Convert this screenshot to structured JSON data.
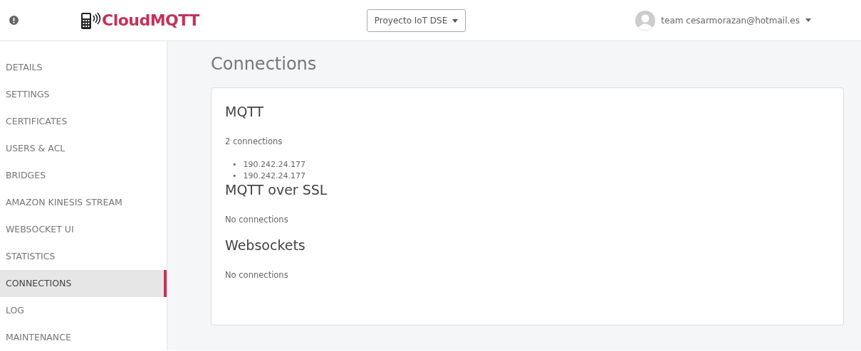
{
  "header": {
    "brand": "CloudMQTT",
    "instance_select": "Proyecto IoT DSE",
    "user": "team cesarmorazan@hotmail.es"
  },
  "sidebar": {
    "items": [
      {
        "label": "DETAILS",
        "selected": false
      },
      {
        "label": "SETTINGS",
        "selected": false
      },
      {
        "label": "CERTIFICATES",
        "selected": false
      },
      {
        "label": "USERS & ACL",
        "selected": false
      },
      {
        "label": "BRIDGES",
        "selected": false
      },
      {
        "label": "AMAZON KINESIS STREAM",
        "selected": false
      },
      {
        "label": "WEBSOCKET UI",
        "selected": false
      },
      {
        "label": "STATISTICS",
        "selected": false
      },
      {
        "label": "CONNECTIONS",
        "selected": true
      },
      {
        "label": "LOG",
        "selected": false
      },
      {
        "label": "MAINTENANCE",
        "selected": false
      }
    ]
  },
  "page_title": "Connections",
  "sections": [
    {
      "title": "MQTT",
      "summary": "2 connections",
      "connections": [
        {
          "bullet": "•",
          "address": "190.242.24.177"
        },
        {
          "bullet": "•",
          "address": "190.242.24.177"
        }
      ]
    },
    {
      "title": "MQTT over SSL",
      "summary": "No connections"
    },
    {
      "title": "Websockets",
      "summary": "No connections"
    }
  ]
}
